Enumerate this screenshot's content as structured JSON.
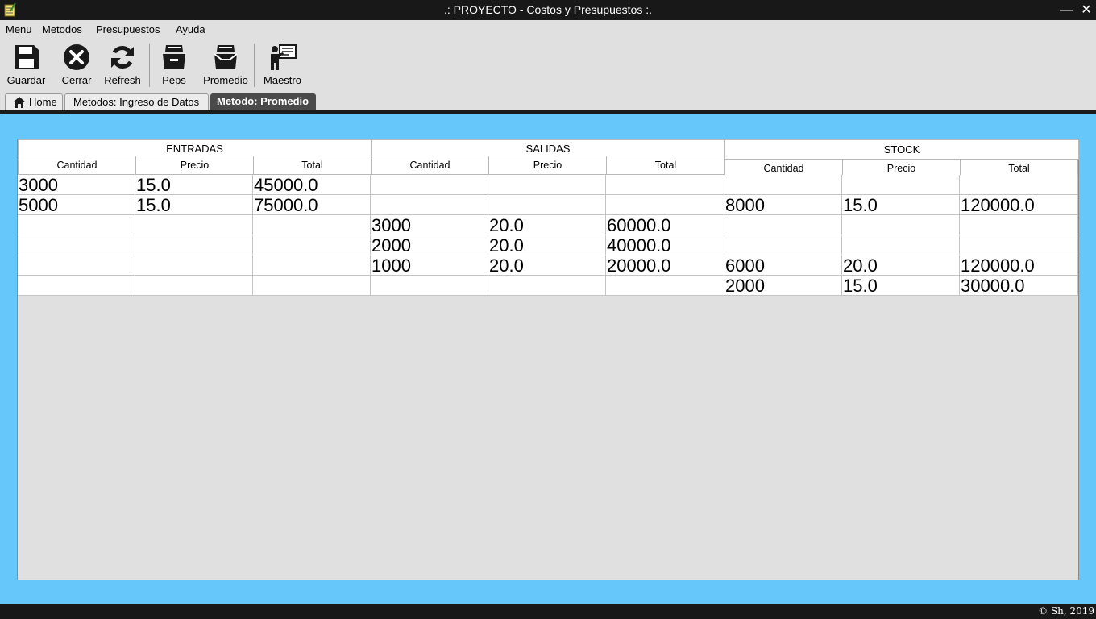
{
  "window": {
    "title": ".: PROYECTO - Costos y Presupuestos :.",
    "minimize_glyph": "—",
    "close_glyph": "✕"
  },
  "menu": [
    "Menu",
    "Metodos",
    "Presupuestos",
    "Ayuda"
  ],
  "toolbar": {
    "save": "Guardar",
    "close": "Cerrar",
    "refresh": "Refresh",
    "peps": "Peps",
    "average": "Promedio",
    "teacher": "Maestro"
  },
  "tabs": {
    "home": "Home",
    "ingreso": "Metodos: Ingreso de Datos",
    "promedio": "Metodo: Promedio"
  },
  "table": {
    "groups": [
      "ENTRADAS",
      "SALIDAS",
      "STOCK"
    ],
    "columns": [
      "Cantidad",
      "Precio",
      "Total",
      "Cantidad",
      "Precio",
      "Total",
      "Cantidad",
      "Precio",
      "Total"
    ],
    "rows": [
      [
        "3000",
        "15.0",
        "45000.0",
        "",
        "",
        "",
        "",
        "",
        ""
      ],
      [
        "5000",
        "15.0",
        "75000.0",
        "",
        "",
        "",
        "8000",
        "15.0",
        "120000.0"
      ],
      [
        "",
        "",
        "",
        "3000",
        "20.0",
        "60000.0",
        "",
        "",
        ""
      ],
      [
        "",
        "",
        "",
        "2000",
        "20.0",
        "40000.0",
        "",
        "",
        ""
      ],
      [
        "",
        "",
        "",
        "1000",
        "20.0",
        "20000.0",
        "6000",
        "20.0",
        "120000.0"
      ],
      [
        "",
        "",
        "",
        "",
        "",
        "",
        "2000",
        "15.0",
        "30000.0"
      ]
    ]
  },
  "status": {
    "copyright": "© Sh, 2019"
  },
  "colors": {
    "content_bg": "#66c8fa",
    "titlebar_bg": "#181818",
    "active_tab_bg": "#4a4a4a"
  }
}
